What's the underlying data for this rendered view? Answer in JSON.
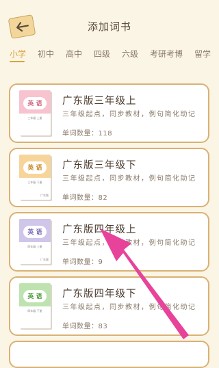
{
  "header": {
    "title": "添加词书",
    "back_icon": "back-arrow-icon"
  },
  "tabs": [
    {
      "label": "小学",
      "active": true
    },
    {
      "label": "初中"
    },
    {
      "label": "高中"
    },
    {
      "label": "四级"
    },
    {
      "label": "六级"
    },
    {
      "label": "考研考博"
    },
    {
      "label": "留学"
    }
  ],
  "books": [
    {
      "title": "广东版三年级上",
      "desc": "三年级起点，同步教材，例句简化助记",
      "count": "单词数量：118",
      "cover_text": "英 语",
      "cover_sub": "三年级 上册",
      "cover_color": "#f6c3cf"
    },
    {
      "title": "广东版三年级下",
      "desc": "三年级起点，同步教材，例句简化助记",
      "count": "单词数量：82",
      "cover_text": "英 语",
      "cover_sub": "三年级 下册",
      "cover_color": "#f7d49a",
      "publisher": "广东版"
    },
    {
      "title": "广东版四年级上",
      "desc": "三年级起点，同步教材，例句简化助记",
      "count": "单词数量：9",
      "cover_text": "英 语",
      "cover_sub": "四年级 上册",
      "cover_color": "#cfc6ea",
      "publisher": "广东版"
    },
    {
      "title": "广东版四年级下",
      "desc": "三年级起点，同步教材，例句简化助记",
      "count": "单词数量：83",
      "cover_text": "英 语",
      "cover_sub": "四年级 下册",
      "cover_color": "#bfe3b0"
    }
  ],
  "colors": {
    "accent": "#d9a43c",
    "card_border": "#d9b173",
    "annotation_arrow": "#e8439a"
  }
}
